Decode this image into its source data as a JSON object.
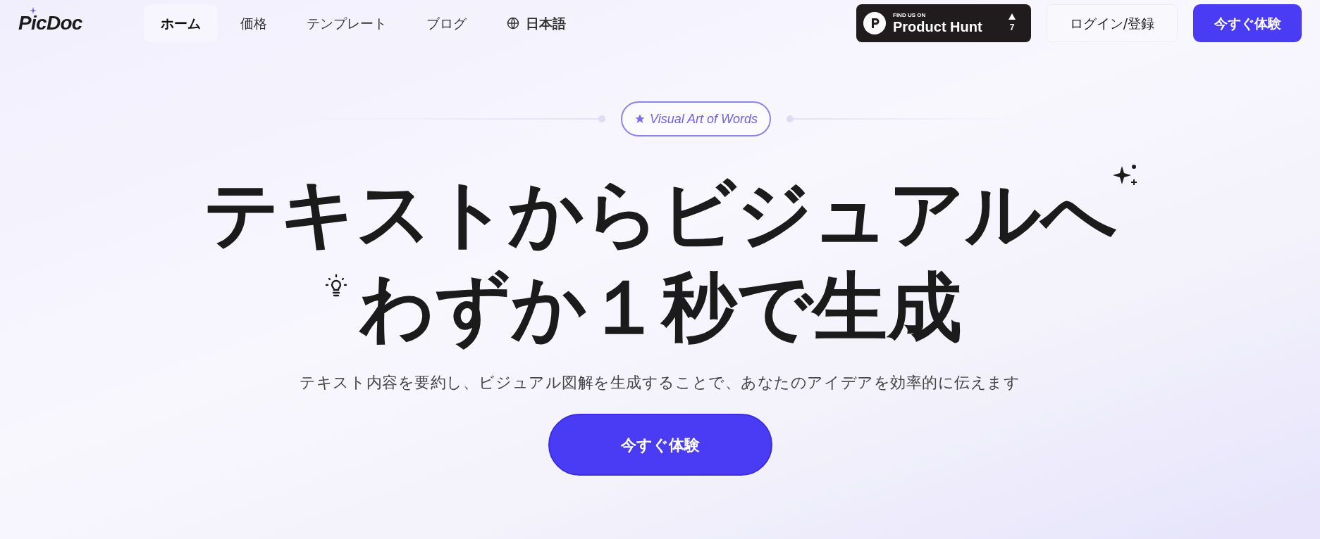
{
  "logo": {
    "text": "PicDoc"
  },
  "nav": [
    {
      "label": "ホーム",
      "selected": true
    },
    {
      "label": "価格",
      "selected": false
    },
    {
      "label": "テンプレート",
      "selected": false
    },
    {
      "label": "ブログ",
      "selected": false
    }
  ],
  "language": "日本語",
  "product_hunt": {
    "eyebrow": "FIND US ON",
    "name": "Product Hunt",
    "votes": "7"
  },
  "login": "ログイン/登録",
  "header_cta": "今すぐ体験",
  "badge": "Visual Art of Words",
  "headline": [
    "テキストからビジュアルへ",
    "わずか１秒で生成"
  ],
  "subtitle": "テキスト内容を要約し、ビジュアル図解を生成することで、あなたのアイデアを効率的に伝えます",
  "cta": "今すぐ体験"
}
